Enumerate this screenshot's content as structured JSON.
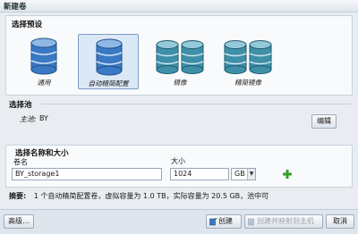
{
  "window": {
    "title": "新建卷"
  },
  "preset_section": {
    "title": "选择预设",
    "presets": [
      {
        "label": "通用",
        "icon": "database-icon",
        "selected": false
      },
      {
        "label": "自动精简配置",
        "icon": "database-thin-icon",
        "selected": true
      },
      {
        "label": "镜像",
        "icon": "database-mirror-icon",
        "selected": false
      },
      {
        "label": "精简镜像",
        "icon": "database-thin-mirror-icon",
        "selected": false
      }
    ]
  },
  "pool_section": {
    "title": "选择池",
    "host_label": "主池:",
    "host_value": "BY",
    "edit_button": "编辑"
  },
  "name_size_section": {
    "title": "选择名称和大小",
    "name_label": "卷名",
    "size_label": "大小",
    "name_value": "BY_storage1",
    "size_value": "1024",
    "unit_value": "GB",
    "add_icon": "plus-icon"
  },
  "summary": {
    "label": "摘要:",
    "text": "1 个自动精简配置卷，虚拟容量为 1.0 TB，实际容量为 20.5 GB，池中可"
  },
  "footer": {
    "advanced_button": "高级...",
    "create_button": "创建",
    "create_map_button": "创建并映射到主机",
    "cancel_button": "取消"
  },
  "colors": {
    "accent": "#2f74c9",
    "db_blue": "#3a79c3",
    "plus_green": "#3b9c2c"
  }
}
